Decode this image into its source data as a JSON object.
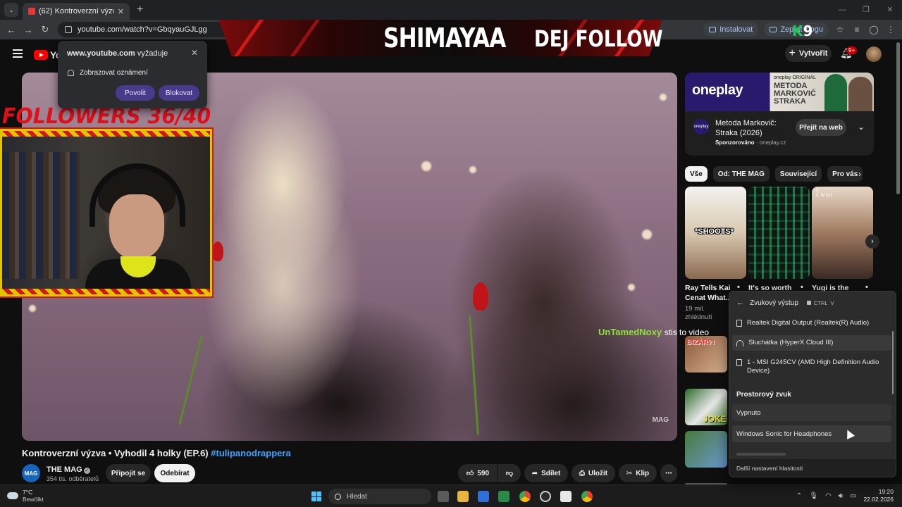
{
  "browser": {
    "tab_title": "(62) Kontroverzní výzva • Vy",
    "url": "youtube.com/watch?v=GbqyauGJLgg",
    "install_label": "Instalovat",
    "ask_label": "Zeptat",
    "ask_label_tail": "oogu"
  },
  "stream": {
    "banner_title": "SHIMAYAA",
    "banner_follow": "DEJ FOLLOW",
    "k9_k": "K",
    "k9_n": "9",
    "followers_text": "FOLLOWERS 36/40",
    "chat_user": "UnTamedNoxy",
    "chat_msg": "stis to video"
  },
  "permission": {
    "site": "www.youtube.com",
    "requires": "vyžaduje",
    "line": "Zobrazovat oznámení",
    "allow": "Povolit",
    "block": "Blokovat"
  },
  "youtube": {
    "logo_text": "Yo",
    "create_label": "Vytvořit",
    "notif_badge": "9+",
    "video_title": "Kontroverzní výzva • Vyhodil 4 holky (EP.6)",
    "video_hashtag": "#tulipanodrappera",
    "watermark": "MAG",
    "channel_avatar": "MAG",
    "channel_name": "THE MAG",
    "channel_subs": "354 tis. odběratelů",
    "join_label": "Připojit se",
    "subscribe_label": "Odebírat",
    "like_count": "590",
    "share_label": "Sdílet",
    "save_label": "Uložit",
    "clip_label": "Klip"
  },
  "ad": {
    "brand": "oneplay",
    "badge": "oneplay ORIGINAL",
    "banner_title_1": "METODA",
    "banner_title_2": "MARKOVIČ",
    "banner_title_3": "STRAKA",
    "logo_text": "oneplay",
    "title": "Metoda Markovič: Straka (2026)",
    "sponsored": "Sponzorováno",
    "domain": "oneplay.cz",
    "cta": "Přejít na web"
  },
  "chips": [
    "Vše",
    "Od: THE MAG",
    "Související",
    "Pro vás"
  ],
  "shorts": [
    {
      "overlay": "*SHOOTS*",
      "caption": "Ray Tells Kai Cenat What...",
      "views": "19 mil. zhlédnutí"
    },
    {
      "overlay": "",
      "caption": "It's so worth"
    },
    {
      "overlay": "2\n3. W rizz",
      "caption": "Yugi is the"
    }
  ],
  "thumbs": [
    {
      "overlay": "BIZÁR?!"
    },
    {
      "overlay": "JOKE"
    }
  ],
  "flyout": {
    "title": "Zvukový výstup",
    "shortcut_ctrl": "CTRL",
    "shortcut_v": "V",
    "devices": [
      "Realtek Digital Output (Realtek(R) Audio)",
      "Sluchátka (HyperX Cloud III)",
      "1 - MSI G245CV (AMD High Definition Audio Device)"
    ],
    "spatial_header": "Prostorový zvuk",
    "spatial_options": [
      "Vypnuto",
      "Windows Sonic for Headphones"
    ],
    "footer": "Další nastavení hlasitosti"
  },
  "taskbar": {
    "temperature": "7°C",
    "weather": "Bewölkt",
    "search_placeholder": "Hledat",
    "time": "19:20",
    "date": "22.02.2026"
  }
}
